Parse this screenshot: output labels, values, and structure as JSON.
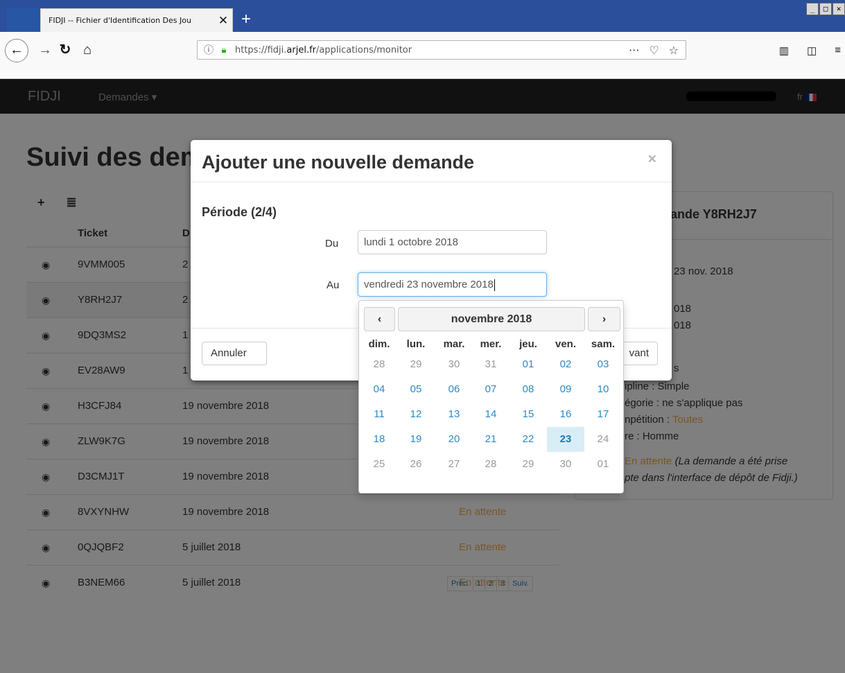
{
  "browser": {
    "tab_title": "FIDJI -- Fichier d'Identification Des Jou",
    "tab_close": "✕",
    "new_tab": "+",
    "window_controls": [
      "_",
      "□",
      "✕"
    ],
    "url_prefix": "https://fidji.",
    "url_domain": "arjel.fr",
    "url_path": "/applications/monitor",
    "icons": [
      "back-icon",
      "forward-icon",
      "reload-icon",
      "home-icon",
      "info-icon",
      "lock-icon",
      "more-icon",
      "pocket-icon",
      "star-icon",
      "library-icon",
      "sidebar-icon",
      "menu-icon"
    ]
  },
  "app": {
    "brand": "FIDJI",
    "menu_demandes": "Demandes ▾",
    "lang": "fr"
  },
  "page": {
    "title": "Suivi des demandes",
    "col_ticket": "Ticket",
    "col_date": "D",
    "rows": [
      {
        "ticket": "9VMM005",
        "date": "2",
        "status": ""
      },
      {
        "ticket": "Y8RH2J7",
        "date": "2",
        "status": ""
      },
      {
        "ticket": "9DQ3MS2",
        "date": "1",
        "status": ""
      },
      {
        "ticket": "EV28AW9",
        "date": "1",
        "status": ""
      },
      {
        "ticket": "H3CFJ84",
        "date": "19 novembre 2018",
        "status": ""
      },
      {
        "ticket": "ZLW9K7G",
        "date": "19 novembre 2018",
        "status": ""
      },
      {
        "ticket": "D3CMJ1T",
        "date": "19 novembre 2018",
        "status": ""
      },
      {
        "ticket": "8VXYNHW",
        "date": "19 novembre 2018",
        "status": "En attente"
      },
      {
        "ticket": "0QJQBF2",
        "date": "5 juillet 2018",
        "status": "En attente"
      },
      {
        "ticket": "B3NEM66",
        "date": "5 juillet 2018",
        "status": "En attente"
      }
    ],
    "pager": [
      "Préc.",
      "1",
      "2",
      "3",
      "Suiv."
    ]
  },
  "detail": {
    "title": "ande Y8RH2J7",
    "date_to": "23 nov. 2018",
    "line_a": "018",
    "line_b": "018",
    "line_s": "s",
    "discipline": "ipline : Simple",
    "categorie": "égorie : ne s'applique pas",
    "competition_label": "npétition : ",
    "competition_value": "Toutes",
    "genre": "re : Homme",
    "status_value": "En attente",
    "status_note_1": "(La demande a été prise",
    "status_note_2": "pte dans l'interface de dépôt de Fidji.)"
  },
  "modal": {
    "title": "Ajouter une nouvelle demande",
    "close": "×",
    "step": "Période (2/4)",
    "du_label": "Du",
    "du_value": "lundi 1 octobre 2018",
    "au_label": "Au",
    "au_value": "vendredi 23 novembre 2018",
    "cancel": "Annuler",
    "next": "vant"
  },
  "datepicker": {
    "prev": "‹",
    "month": "novembre 2018",
    "next": "›",
    "weekdays": [
      "dim.",
      "lun.",
      "mar.",
      "mer.",
      "jeu.",
      "ven.",
      "sam."
    ],
    "weeks": [
      [
        "28",
        "29",
        "30",
        "31",
        "01",
        "02",
        "03"
      ],
      [
        "04",
        "05",
        "06",
        "07",
        "08",
        "09",
        "10"
      ],
      [
        "11",
        "12",
        "13",
        "14",
        "15",
        "16",
        "17"
      ],
      [
        "18",
        "19",
        "20",
        "21",
        "22",
        "23",
        "24"
      ],
      [
        "25",
        "26",
        "27",
        "28",
        "29",
        "30",
        "01"
      ]
    ],
    "selected": "23",
    "colors": {
      "active": "#2a8ac9",
      "muted": "#999999",
      "selected_bg": "#d9edf7"
    }
  }
}
